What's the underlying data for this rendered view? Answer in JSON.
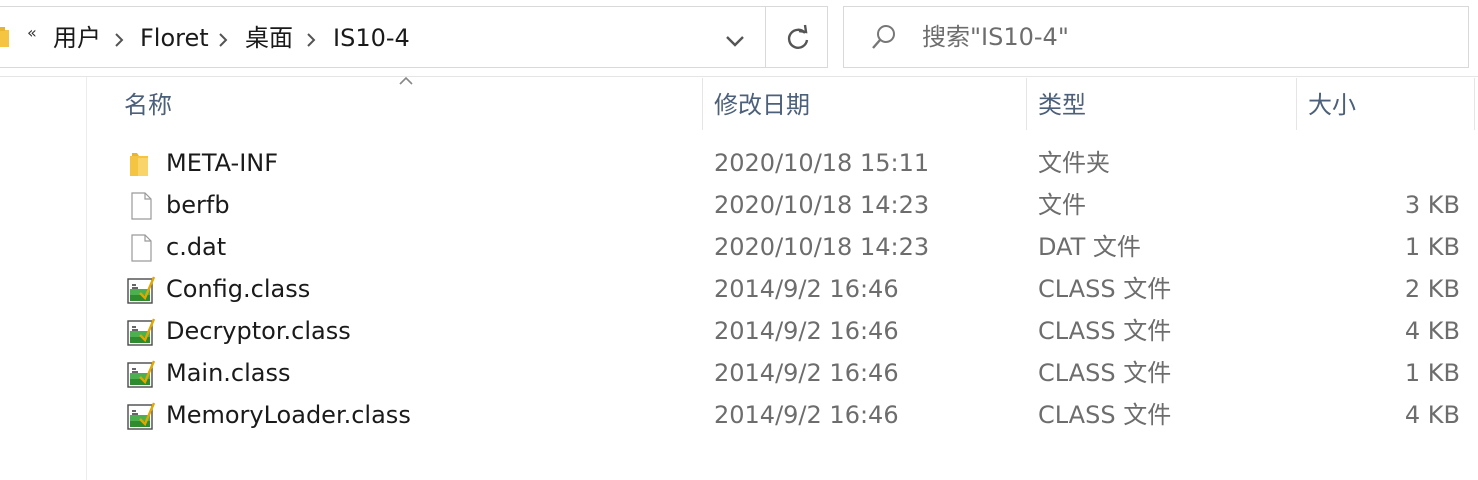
{
  "address": {
    "overflow_glyph": "«",
    "crumbs": [
      "用户",
      "Floret",
      "桌面",
      "IS10-4"
    ]
  },
  "search": {
    "placeholder": "搜索\"IS10-4\""
  },
  "columns": {
    "name": "名称",
    "date": "修改日期",
    "type": "类型",
    "size": "大小"
  },
  "files": [
    {
      "name": "META-INF",
      "date": "2020/10/18 15:11",
      "type": "文件夹",
      "size": "",
      "icon": "folder-icon"
    },
    {
      "name": "berfb",
      "date": "2020/10/18 14:23",
      "type": "文件",
      "size": "3 KB",
      "icon": "file-icon"
    },
    {
      "name": "c.dat",
      "date": "2020/10/18 14:23",
      "type": "DAT 文件",
      "size": "1 KB",
      "icon": "file-icon"
    },
    {
      "name": "Config.class",
      "date": "2014/9/2 16:46",
      "type": "CLASS 文件",
      "size": "2 KB",
      "icon": "java-class-icon"
    },
    {
      "name": "Decryptor.class",
      "date": "2014/9/2 16:46",
      "type": "CLASS 文件",
      "size": "4 KB",
      "icon": "java-class-icon"
    },
    {
      "name": "Main.class",
      "date": "2014/9/2 16:46",
      "type": "CLASS 文件",
      "size": "1 KB",
      "icon": "java-class-icon"
    },
    {
      "name": "MemoryLoader.class",
      "date": "2014/9/2 16:46",
      "type": "CLASS 文件",
      "size": "4 KB",
      "icon": "java-class-icon"
    }
  ],
  "colors": {
    "header_text": "#4c607a",
    "folder": "#f5c542",
    "class_icon_green": "#2e8b2e"
  }
}
